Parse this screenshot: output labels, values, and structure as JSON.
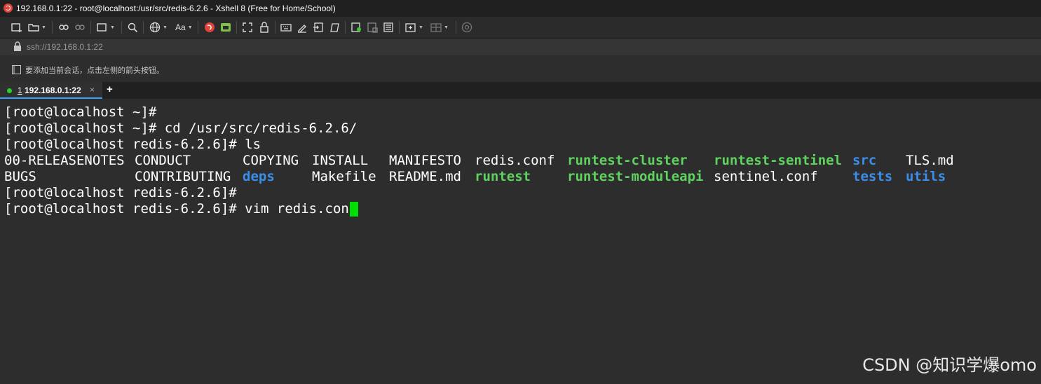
{
  "window": {
    "title": "192.168.0.1:22 - root@localhost:/usr/src/redis-6.2.6 - Xshell 8 (Free for Home/School)"
  },
  "address": {
    "value": "ssh://192.168.0.1:22"
  },
  "session_hint": "要添加当前会话，点击左侧的箭头按钮。",
  "tab": {
    "number": "1",
    "label": "192.168.0.1:22",
    "close": "×",
    "new": "+"
  },
  "terminal": {
    "lines": [
      "[root@localhost ~]#",
      "[root@localhost ~]# cd /usr/src/redis-6.2.6/",
      "[root@localhost redis-6.2.6]# ls"
    ],
    "ls_row1": [
      {
        "name": "00-RELEASENOTES",
        "type": "file"
      },
      {
        "name": "CONDUCT",
        "type": "file"
      },
      {
        "name": "COPYING",
        "type": "file"
      },
      {
        "name": "INSTALL",
        "type": "file"
      },
      {
        "name": "MANIFESTO",
        "type": "file"
      },
      {
        "name": "redis.conf",
        "type": "file"
      },
      {
        "name": "runtest-cluster",
        "type": "exec"
      },
      {
        "name": "runtest-sentinel",
        "type": "exec"
      },
      {
        "name": "src",
        "type": "dir"
      },
      {
        "name": "TLS.md",
        "type": "file"
      }
    ],
    "ls_row2": [
      {
        "name": "BUGS",
        "type": "file"
      },
      {
        "name": "CONTRIBUTING",
        "type": "file"
      },
      {
        "name": "deps",
        "type": "dir"
      },
      {
        "name": "Makefile",
        "type": "file"
      },
      {
        "name": "README.md",
        "type": "file"
      },
      {
        "name": "runtest",
        "type": "exec"
      },
      {
        "name": "runtest-moduleapi",
        "type": "exec"
      },
      {
        "name": "sentinel.conf",
        "type": "file"
      },
      {
        "name": "tests",
        "type": "dir"
      },
      {
        "name": "utils",
        "type": "dir"
      }
    ],
    "after_lines": [
      "[root@localhost redis-6.2.6]#",
      "[root@localhost redis-6.2.6]# vim redis.conf "
    ]
  },
  "watermark": "CSDN @知识学爆omo",
  "colors": {
    "dir": "#3b8eea",
    "exec": "#5fd35f",
    "cursor": "#00e000",
    "tab_dot": "#28d028"
  },
  "toolbar_icons": [
    "new-session-icon",
    "open-folder-icon",
    "connect-icon",
    "disconnect-icon",
    "new-window-icon",
    "find-icon",
    "globe-icon",
    "font-icon",
    "xshell-icon",
    "xftp-icon",
    "fullscreen-icon",
    "lock-icon",
    "keyboard-icon",
    "highlight-icon",
    "script-icon",
    "compose-icon",
    "log-icon",
    "transfer-icon",
    "tile-icon",
    "layout-icon",
    "add-folder-icon",
    "split-icon",
    "help-icon"
  ]
}
